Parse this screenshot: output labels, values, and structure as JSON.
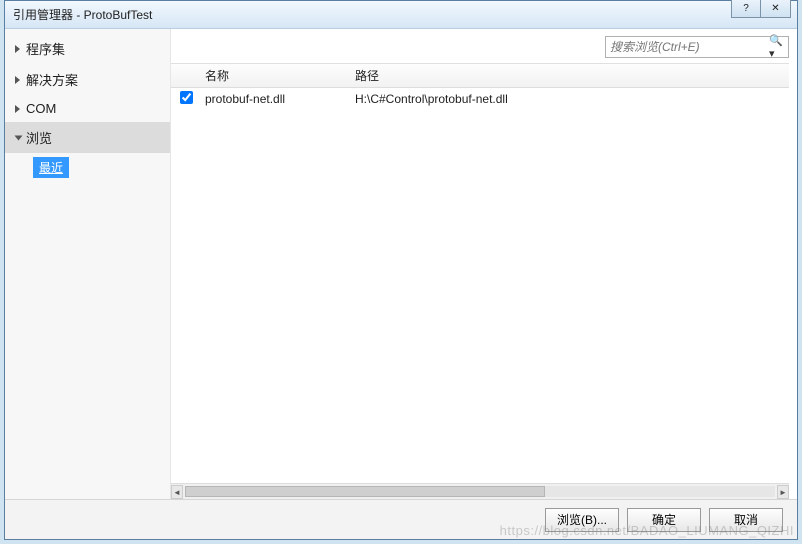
{
  "window": {
    "title": "引用管理器 - ProtoBufTest"
  },
  "sidebar": {
    "items": [
      {
        "label": "程序集",
        "expanded": false
      },
      {
        "label": "解决方案",
        "expanded": false
      },
      {
        "label": "COM",
        "expanded": false
      },
      {
        "label": "浏览",
        "expanded": true
      }
    ],
    "subitem": "最近"
  },
  "search": {
    "placeholder": "搜索浏览(Ctrl+E)"
  },
  "list": {
    "headers": {
      "name": "名称",
      "path": "路径"
    },
    "rows": [
      {
        "checked": true,
        "name": "protobuf-net.dll",
        "path": "H:\\C#Control\\protobuf-net.dll"
      }
    ]
  },
  "footer": {
    "browse": "浏览(B)...",
    "ok": "确定",
    "cancel": "取消"
  },
  "watermark": "https://blog.csdn.net/BADAO_LIUMANG_QIZHI"
}
